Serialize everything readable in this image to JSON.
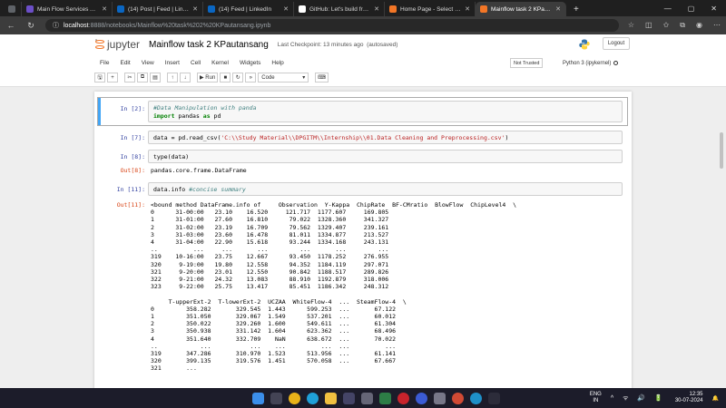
{
  "browser": {
    "tabs": [
      {
        "title": "",
        "color": "#5f6368",
        "active": false,
        "icon": "sidebar-icon"
      },
      {
        "title": "Main Flow Services And Technologies",
        "color": "#6c4fc8",
        "active": false,
        "icon": "mainflow-icon"
      },
      {
        "title": "(14) Post | Feed | LinkedIn",
        "color": "#0a66c2",
        "active": false,
        "icon": "linkedin-icon"
      },
      {
        "title": "(14) Feed | LinkedIn",
        "color": "#0a66c2",
        "active": false,
        "icon": "linkedin-icon"
      },
      {
        "title": "GitHub: Let's build from here",
        "color": "#ffffff",
        "active": false,
        "icon": "github-icon"
      },
      {
        "title": "Home Page - Select or create",
        "color": "#f37626",
        "active": false,
        "icon": "jupyter-icon"
      },
      {
        "title": "Mainflow task 2 KPautansang",
        "color": "#f37626",
        "active": true,
        "icon": "jupyter-icon"
      }
    ],
    "new_tab": "+",
    "url_host": "localhost",
    "url_path": ":8888/notebooks/Mainflow%20task%202%20KPautansang.ipynb",
    "win_min": "—",
    "win_max": "▢",
    "win_close": "✕"
  },
  "jupyter": {
    "logo_text": "jupyter",
    "notebook_title": "Mainflow task 2 KPautansang",
    "checkpoint": "Last Checkpoint: 13 minutes ago",
    "autosaved": "(autosaved)",
    "logout": "Logout",
    "menu": [
      "File",
      "Edit",
      "View",
      "Insert",
      "Cell",
      "Kernel",
      "Widgets",
      "Help"
    ],
    "trust": "Not Trusted",
    "kernel": "Python 3 (ipykernel)",
    "run_label": "Run",
    "cell_type": "Code"
  },
  "cells": [
    {
      "prompt": "In [2]:",
      "lines": [
        "#Data Manipulation with panda",
        "import pandas as pd"
      ]
    },
    {
      "prompt": "In [7]:",
      "code": "data = pd.read_csv('C:\\\\Study Material\\\\DPGITM\\\\Internship\\\\01.Data Cleaning and Preprocessing.csv')"
    },
    {
      "prompt": "In [8]:",
      "code": "type(data)"
    },
    {
      "out_prompt": "Out[8]:",
      "output": "pandas.core.frame.DataFrame"
    },
    {
      "prompt": "In [11]:",
      "code": "data.info",
      "comment": " #concise summary"
    },
    {
      "out_prompt": "Out[11]:",
      "output": "<bound method DataFrame.info of     Observation  Y-Kappa  ChipRate  BF-CMratio  BlowFlow  ChipLevel4  \\\n0      31-00:00   23.10    16.520     121.717  1177.607     169.805\n1      31-01:00   27.60    16.810      79.022  1328.360     341.327\n2      31-02:00   23.19    16.709      79.562  1329.407     239.161\n3      31-03:00   23.60    16.478      81.011  1334.877     213.527\n4      31-04:00   22.90    15.618      93.244  1334.168     243.131\n..          ...     ...       ...         ...       ...         ...\n319    10-16:00   23.75    12.667      93.450  1178.252     276.955\n320     9-19:00   19.80    12.558      94.352  1184.119     297.071\n321     9-20:00   23.01    12.550      90.842  1188.517     289.826\n322     9-21:00   24.32    13.083      88.910  1192.879     318.006\n323     9-22:00   25.75    13.417      85.451  1186.342     248.312\n\n     T-upperExt-2  T-lowerExt-2  UCZAA  WhiteFlow-4  ...  SteamFlow-4  \\\n0         358.282       329.545  1.443      599.253  ...       67.122\n1         351.050       329.067  1.549      537.201  ...       60.012\n2         350.022       329.260  1.600      549.611  ...       61.304\n3         350.938       331.142  1.604      623.362  ...       68.496\n4         351.640       332.709    NaN      638.672  ...       70.022\n..            ...           ...    ...          ...  ...          ...\n319       347.286       310.970  1.523      513.956  ...       61.141\n320       399.135       319.576  1.451      570.058  ...       67.667\n321       ...\n"
    }
  ],
  "taskbar": {
    "lang_top": "ENG",
    "lang_bottom": "IN",
    "time": "12:35",
    "date": "30-07-2024",
    "sys_icons": "^ ᯤ 🔊 🔋",
    "apps": [
      {
        "name": "windows-start-icon",
        "color": "#3b8eea"
      },
      {
        "name": "search-icon",
        "color": "#444455"
      },
      {
        "name": "chrome-icon",
        "color": "#e8b219"
      },
      {
        "name": "edge-icon",
        "color": "#1fa0d8"
      },
      {
        "name": "file-explorer-icon",
        "color": "#f0c040"
      },
      {
        "name": "store-icon",
        "color": "#444466"
      },
      {
        "name": "settings-icon",
        "color": "#666677"
      },
      {
        "name": "app-icon",
        "color": "#2d7d46"
      },
      {
        "name": "pinterest-icon",
        "color": "#c8232c"
      },
      {
        "name": "vpn-icon",
        "color": "#3b5bd4"
      },
      {
        "name": "mail-icon",
        "color": "#777788"
      },
      {
        "name": "chrome-alt-icon",
        "color": "#d04a34"
      },
      {
        "name": "edge-alt-icon",
        "color": "#1e90c8"
      },
      {
        "name": "terminal-icon",
        "color": "#2c2c3a"
      }
    ]
  }
}
